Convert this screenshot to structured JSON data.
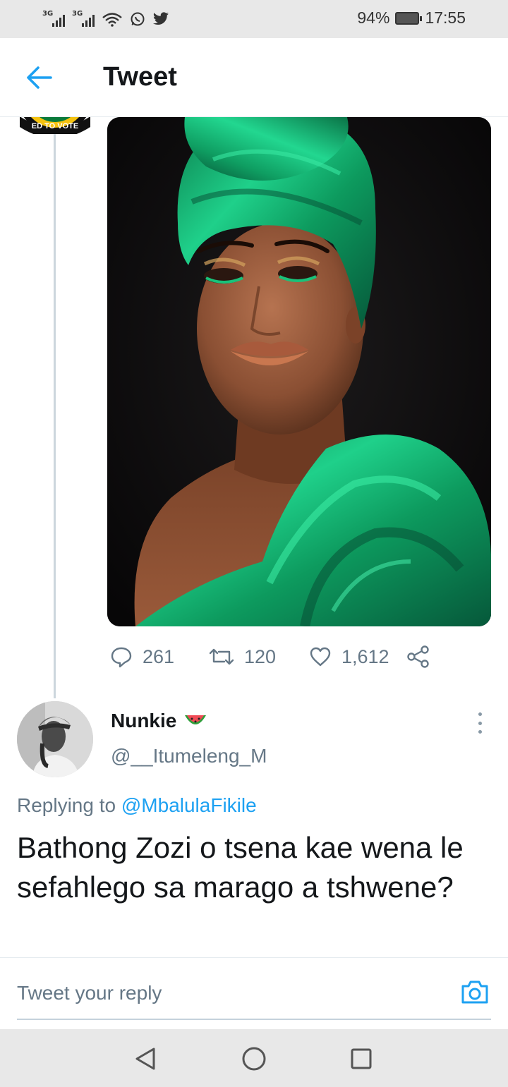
{
  "status_bar": {
    "network_1": "3G",
    "network_2": "3G",
    "battery": "94%",
    "time": "17:55",
    "icons": [
      "signal-icon",
      "signal-icon",
      "wifi-icon",
      "whatsapp-icon",
      "twitter-icon",
      "battery-icon"
    ]
  },
  "header": {
    "title": "Tweet",
    "back_icon": "arrow-left-icon"
  },
  "original_tweet": {
    "avatar_text": "ED TO VOTE",
    "stats": {
      "replies": "261",
      "retweets": "120",
      "likes": "1,612"
    }
  },
  "reply": {
    "name": "Nunkie",
    "name_emoji": "watermelon-icon",
    "handle": "@__Itumeleng_M",
    "replying_prefix": "Replying to",
    "replying_to": "@MbalulaFikile",
    "text": "Bathong Zozi o tsena kae wena le sefahlego sa marago a tshwene?"
  },
  "composer": {
    "placeholder": "Tweet your reply"
  },
  "colors": {
    "accent": "#1da1f2",
    "muted": "#657786",
    "text": "#14171a",
    "satin_green": "#12a86a"
  }
}
